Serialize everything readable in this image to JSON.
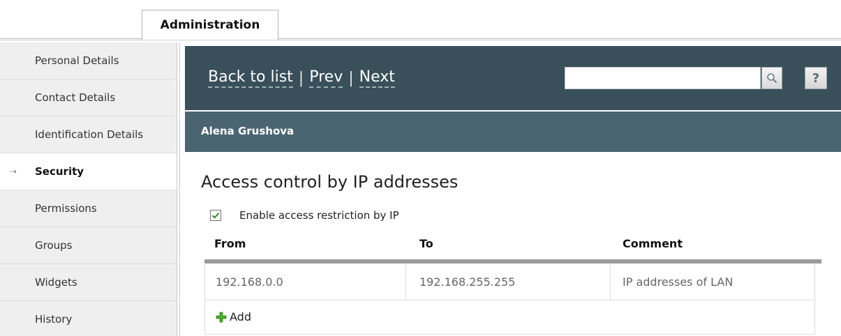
{
  "tabs": [
    {
      "label": "Administration"
    }
  ],
  "sidebar": {
    "items": [
      {
        "label": "Personal Details"
      },
      {
        "label": "Contact Details"
      },
      {
        "label": "Identification Details"
      },
      {
        "label": "Security",
        "active": true
      },
      {
        "label": "Permissions"
      },
      {
        "label": "Groups"
      },
      {
        "label": "Widgets"
      },
      {
        "label": "History"
      }
    ]
  },
  "header": {
    "back_label": "Back to list",
    "prev_label": "Prev",
    "next_label": "Next",
    "separator": "|",
    "search": {
      "value": "",
      "placeholder": ""
    },
    "help_label": "?",
    "colors": {
      "bar": "#394f5a",
      "subbar": "#4a6571"
    }
  },
  "record": {
    "name": "Alena Grushova"
  },
  "security": {
    "title": "Access control by IP addresses",
    "enable_label": "Enable access restriction by IP",
    "enable_checked": true,
    "columns": [
      "From",
      "To",
      "Comment"
    ],
    "rows": [
      {
        "from": "192.168.0.0",
        "to": "192.168.255.255",
        "comment": "IP addresses of LAN"
      }
    ],
    "add_label": "Add"
  }
}
